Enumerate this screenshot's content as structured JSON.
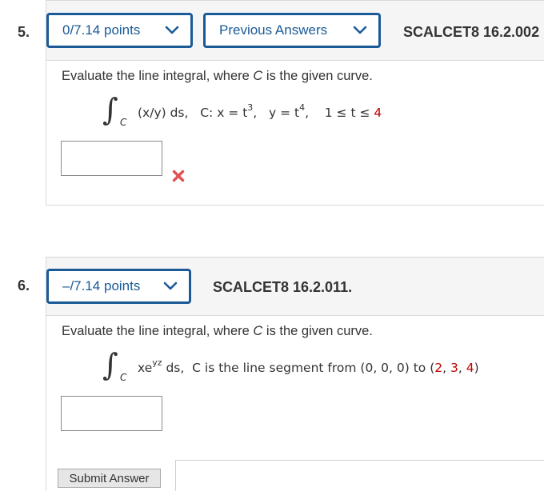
{
  "q5": {
    "number": "5.",
    "points": "0/7.14 points",
    "previous_answers": "Previous Answers",
    "code": "SCALCET8 16.2.002",
    "prompt_pre": "Evaluate the line integral, where ",
    "prompt_var": "C",
    "prompt_post": " is the given curve.",
    "int_sub": "C",
    "integrand": "(x/y) ds,",
    "curve_label": "C:",
    "x_eq": "x = t",
    "x_exp": "3",
    "x_comma": ",",
    "y_eq": "y = t",
    "y_exp": "4",
    "y_comma": ",",
    "range_pre": "1 ≤ t ≤ ",
    "range_upper": "4",
    "answer_value": ""
  },
  "q6": {
    "number": "6.",
    "points": "–/7.14 points",
    "code": "SCALCET8 16.2.011.",
    "prompt_pre": "Evaluate the line integral, where ",
    "prompt_var": "C",
    "prompt_post": " is the given curve.",
    "int_sub": "C",
    "integrand_base": "xe",
    "integrand_exp": "yz",
    "integrand_post": " ds,",
    "segment_text": "C  is the line segment from  (0, 0, 0) to (",
    "p2": "2",
    "sep1": ", ",
    "p3": "3",
    "sep2": ", ",
    "p4": "4",
    "close": ")",
    "answer_value": "",
    "submit_label": "Submit Answer"
  },
  "colors": {
    "accent": "#1a5a96",
    "error": "#e05252",
    "highlight": "#c00000"
  },
  "icons": {
    "chevron": "chevron-down-icon",
    "incorrect": "x-mark-icon"
  }
}
